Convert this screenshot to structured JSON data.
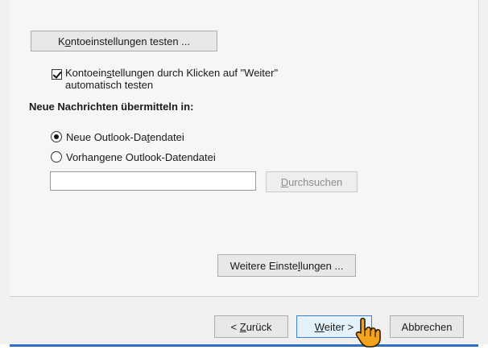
{
  "test_settings_button": {
    "prefix": "K",
    "underlined": "o",
    "suffix": "ntoeinstellungen testen ..."
  },
  "auto_test_checkbox": {
    "checked": true,
    "line1_prefix": "Kontoein",
    "line1_underlined": "s",
    "line1_suffix": "tellungen durch Klicken auf \"Weiter\"",
    "line2": "automatisch testen"
  },
  "deliver_heading": "Neue Nachrichten übermitteln in:",
  "radio_new": {
    "selected": true,
    "prefix": "Neue Outlook-Da",
    "underlined": "t",
    "suffix": "endatei"
  },
  "radio_existing": {
    "selected": false,
    "prefix": "Vorhan",
    "underlined": "g",
    "suffix": "ene Outlook-Datendatei"
  },
  "path_input": {
    "value": ""
  },
  "browse_button": {
    "underlined": "D",
    "suffix": "urchsuchen",
    "disabled": true
  },
  "more_settings_button": {
    "prefix": "Weitere Einste",
    "underlined": "l",
    "suffix": "lungen ..."
  },
  "footer": {
    "back": {
      "prefix": "< ",
      "underlined": "Z",
      "suffix": "urück"
    },
    "next": {
      "underlined": "W",
      "suffix": "eiter >"
    },
    "cancel": "Abbrechen"
  },
  "colors": {
    "accent": "#2f6fbf",
    "cursor": "#f4a11b"
  },
  "cursor_icon": "hand-pointer-icon"
}
